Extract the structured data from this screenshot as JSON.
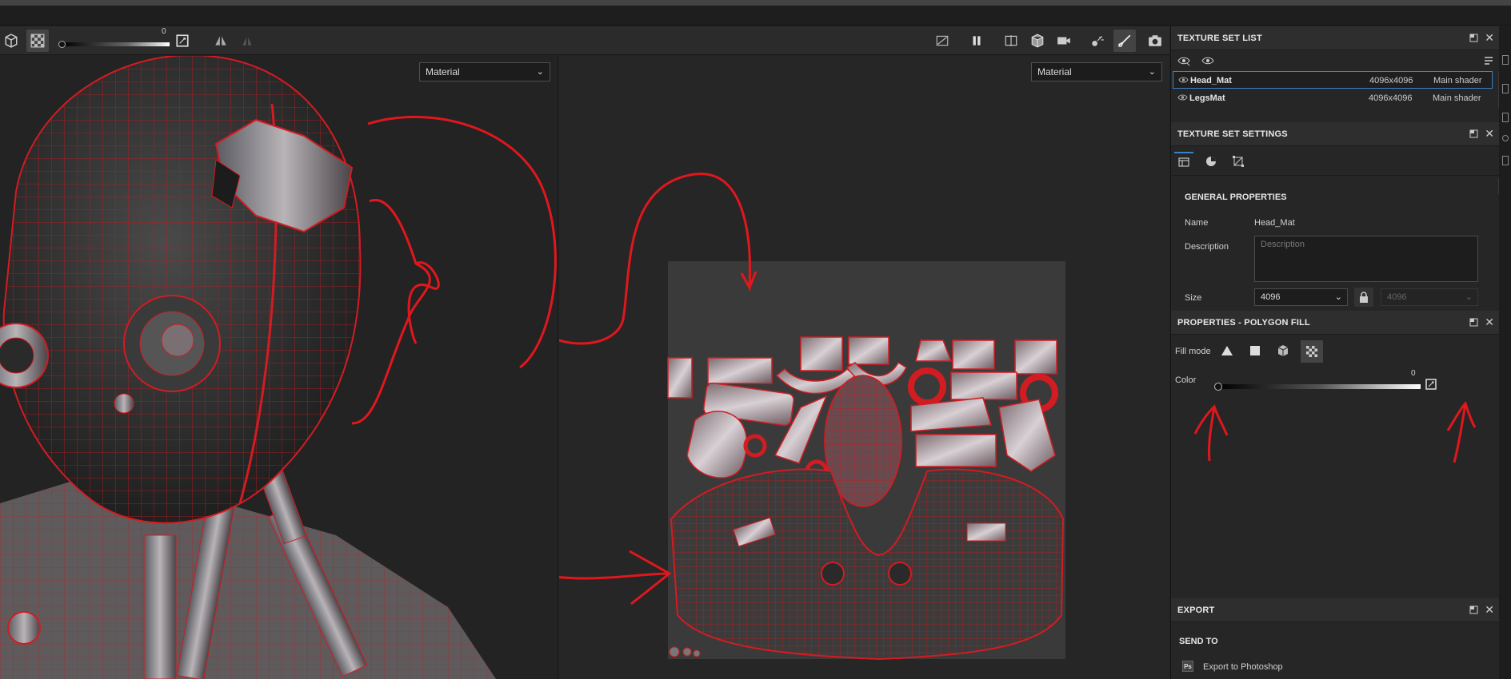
{
  "toolbar": {
    "slider_value": "0"
  },
  "viewport_left": {
    "channel_select": "Material"
  },
  "viewport_right": {
    "channel_select": "Material"
  },
  "texture_set_list": {
    "title": "TEXTURE SET LIST",
    "rows": [
      {
        "name": "Head_Mat",
        "resolution": "4096x4096",
        "shader": "Main shader"
      },
      {
        "name": "LegsMat",
        "resolution": "4096x4096",
        "shader": "Main shader"
      }
    ]
  },
  "texture_set_settings": {
    "title": "TEXTURE SET SETTINGS",
    "section": "GENERAL PROPERTIES",
    "name_label": "Name",
    "name_value": "Head_Mat",
    "description_label": "Description",
    "description_placeholder": "Description",
    "size_label": "Size",
    "size_value": "4096",
    "size_linked_value": "4096"
  },
  "polygon_fill": {
    "title": "PROPERTIES - POLYGON FILL",
    "fill_mode_label": "Fill mode",
    "color_label": "Color",
    "color_value": "0"
  },
  "export": {
    "title": "EXPORT",
    "send_to": "SEND TO",
    "photoshop": "Export to Photoshop"
  },
  "colors": {
    "wireframe": "#e0171d",
    "selection": "#3b82c4",
    "panel_bg": "#262626"
  }
}
